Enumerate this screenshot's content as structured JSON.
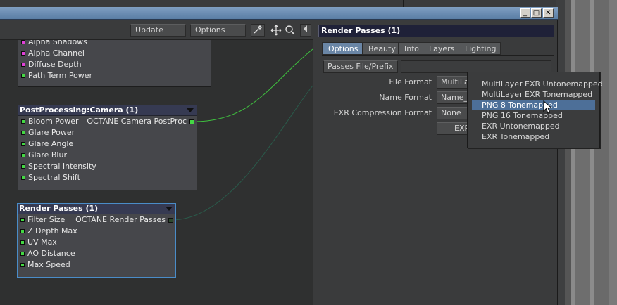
{
  "window": {
    "buttons": [
      "_",
      "□",
      "✕"
    ]
  },
  "toolbar": {
    "update_label": "Update",
    "options_label": "Options",
    "icons": [
      "pipette-icon",
      "move-icon",
      "zoom-icon",
      "collapse-left-icon"
    ]
  },
  "nodes": {
    "top_partial": {
      "ports": [
        {
          "label": "Alpha Shadows",
          "color": "#e040d8"
        },
        {
          "label": "Alpha Channel",
          "color": "#e040d8"
        },
        {
          "label": "Diffuse Depth",
          "color": "#e040d8"
        },
        {
          "label": "Path Term Power",
          "color": "#44d844"
        }
      ]
    },
    "postprocessing": {
      "title": "PostProcessing:Camera (1)",
      "output": "OCTANE Camera PostProc",
      "ports": [
        "Bloom Power",
        "Glare Power",
        "Glare Angle",
        "Glare Blur",
        "Spectral Intensity",
        "Spectral Shift"
      ]
    },
    "render_passes": {
      "title": "Render Passes (1)",
      "output": "OCTANE Render Passes",
      "ports": [
        "Filter Size",
        "Z Depth Max",
        "UV Max",
        "AO Distance",
        "Max Speed"
      ]
    }
  },
  "panel": {
    "title": "Render Passes (1)",
    "tabs": [
      "Options",
      "Beauty",
      "Info",
      "Layers",
      "Lighting"
    ],
    "active_tab": "Options",
    "passes_file_prefix_label": "Passes File/Prefix",
    "file_format_label": "File Format",
    "file_format_value": "MultiLay",
    "name_format_label": "Name Format",
    "name_format_value": "Name_p",
    "exr_compression_label": "EXR Compression Format",
    "exr_compression_value": "None",
    "exr_button_label": "EXR"
  },
  "dropdown": {
    "items": [
      "MultiLayer EXR Untonemapped",
      "MultiLayer EXR Tonemapped",
      "PNG 8 Tonemapped",
      "PNG 16 Tonemapped",
      "EXR Untonemapped",
      "EXR Tonemapped"
    ],
    "highlighted": "PNG 8 Tonemapped"
  },
  "colors": {
    "accent": "#4d6f98",
    "node_header": "#363a52",
    "link_green": "#3fbf3f",
    "port_magenta": "#e040d8",
    "port_green": "#44d844"
  }
}
